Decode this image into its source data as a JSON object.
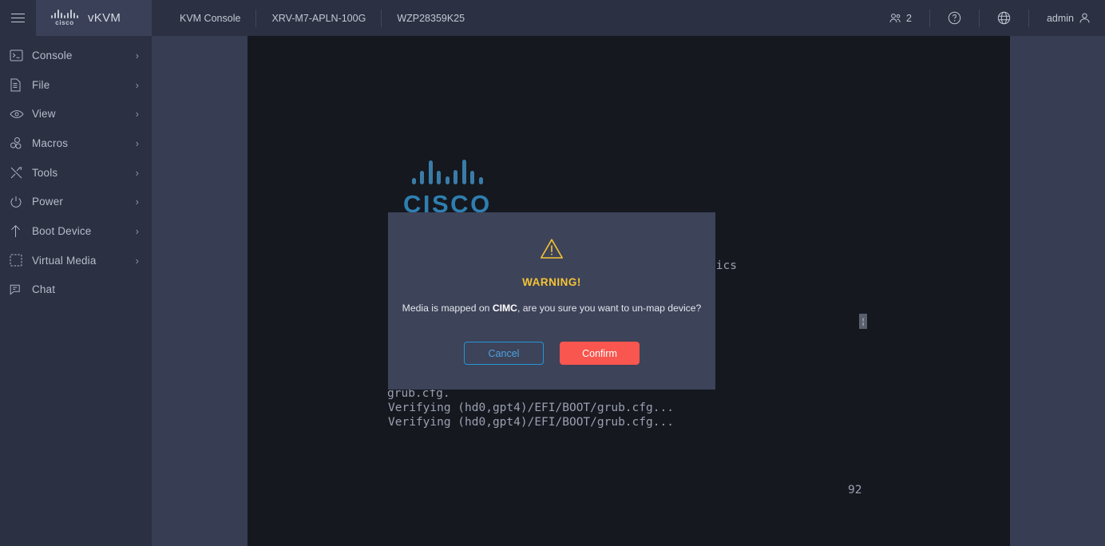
{
  "header": {
    "menu_icon": "hamburger-icon",
    "brand": {
      "logo": "cisco-logo",
      "title": "vKVM"
    },
    "tabs": [
      {
        "label": "KVM Console"
      },
      {
        "label": "XRV-M7-APLN-100G"
      },
      {
        "label": "WZP28359K25"
      }
    ],
    "right": {
      "users_icon": "users-icon",
      "users_count": "2",
      "help_icon": "help-circle-icon",
      "language_icon": "globe-icon",
      "user_label": "admin",
      "user_icon": "user-icon"
    }
  },
  "sidebar": {
    "items": [
      {
        "label": "Console",
        "icon": "console-icon",
        "chevron": "›"
      },
      {
        "label": "File",
        "icon": "file-icon",
        "chevron": "›"
      },
      {
        "label": "View",
        "icon": "eye-icon",
        "chevron": "›"
      },
      {
        "label": "Macros",
        "icon": "macros-icon",
        "chevron": "›"
      },
      {
        "label": "Tools",
        "icon": "tools-icon",
        "chevron": "›"
      },
      {
        "label": "Power",
        "icon": "power-icon",
        "chevron": "›"
      },
      {
        "label": "Boot Device",
        "icon": "arrow-up-icon",
        "chevron": "›"
      },
      {
        "label": "Virtual Media",
        "icon": "virtual-media-icon",
        "chevron": "›"
      },
      {
        "label": "Chat",
        "icon": "chat-icon",
        "chevron": ""
      }
    ]
  },
  "terminal": {
    "logo_word": "CISCO",
    "lines": [
      {
        "text": "tics",
        "left": "578",
        "top": "280"
      },
      {
        "text": "grub.cfg.",
        "left": "175",
        "top": "440"
      },
      {
        "text": "Verifying (hd0,gpt4)/EFI/BOOT/grub.cfg...",
        "left": "176",
        "top": "458"
      },
      {
        "text": "Verifying (hd0,gpt4)/EFI/BOOT/grub.cfg...",
        "left": "176",
        "top": "476"
      }
    ],
    "cursor_glyph": "¦",
    "counter": "92"
  },
  "modal": {
    "icon": "warning-triangle-icon",
    "title": "WARNING!",
    "message_prefix": "Media is mapped on ",
    "message_bold": "CIMC",
    "message_suffix": ", are you sure you want to un-map device?",
    "cancel_label": "Cancel",
    "confirm_label": "Confirm"
  },
  "colors": {
    "header_bg": "#2b3042",
    "sidebar_bg": "#2b3042",
    "panel_bg": "#373d52",
    "terminal_bg": "#15181f",
    "modal_bg": "#3d4359",
    "warning": "#f5c435",
    "confirm": "#f8564e",
    "cancel_border": "#2196d9",
    "cisco_blue": "#2f7fb0"
  }
}
